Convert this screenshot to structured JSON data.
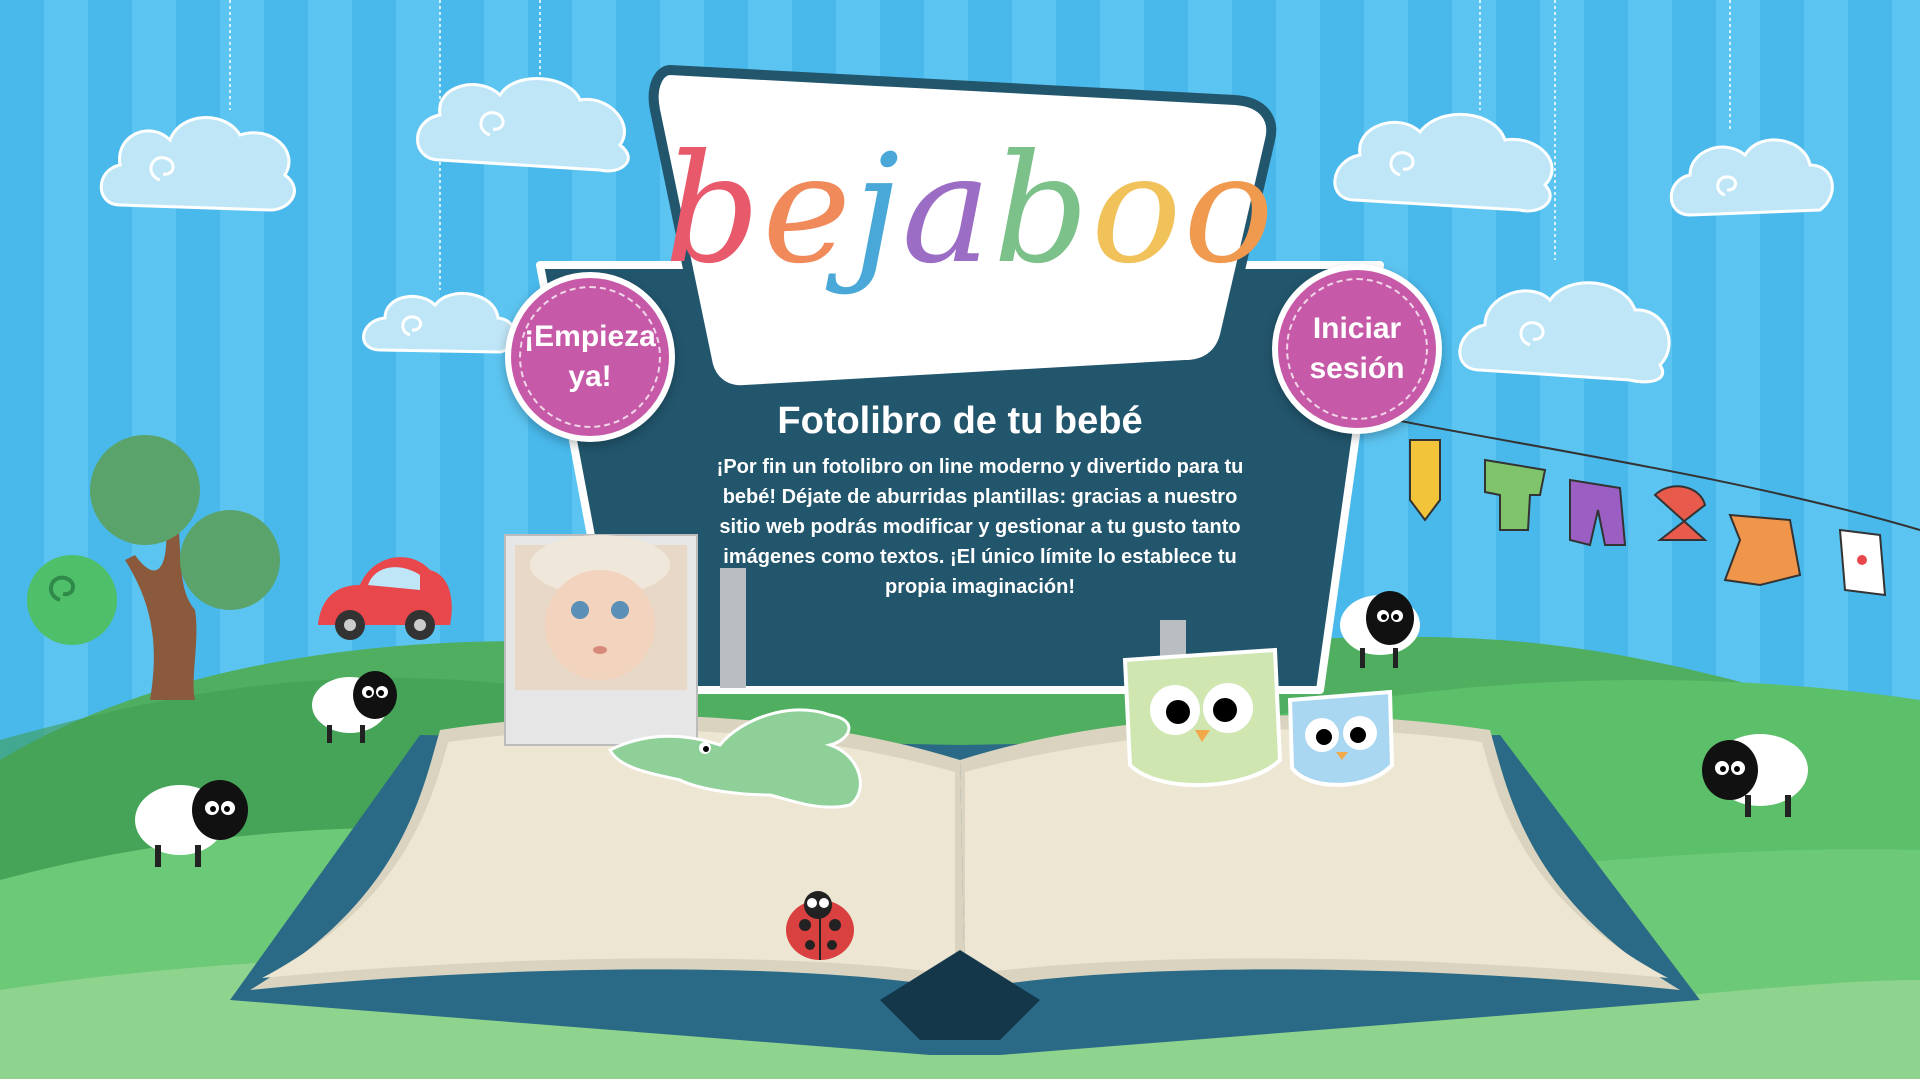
{
  "logo": {
    "letters": [
      "b",
      "e",
      "j",
      "a",
      "b",
      "o",
      "o"
    ],
    "colors": [
      "#e85a6b",
      "#f08a5a",
      "#4aa8d8",
      "#9b6dc4",
      "#7cc08a",
      "#f1c15a",
      "#f09a50"
    ]
  },
  "headline": "Fotolibro de tu bebé",
  "intro": "¡Por fin un fotolibro on line moderno y divertido para tu bebé! Déjate de aburridas plantillas: gracias a nuestro sitio web podrás modificar y gestionar a tu gusto tanto imágenes como textos. ¡El único límite lo establece tu propia imaginación!",
  "buttons": {
    "start_label": "¡Empieza\nya!",
    "login_label": "Iniciar\nsesión"
  },
  "icons": [
    "cloud-icon",
    "tree-icon",
    "car-icon",
    "sheep-icon",
    "owl-icon",
    "crocodile-icon",
    "ladybug-icon",
    "clothesline-icon",
    "open-book-icon",
    "baby-photo"
  ],
  "colors": {
    "sky": "#49b8ea",
    "hill": "#5cbf6a",
    "sign": "#22566d",
    "button": "#c75aa8"
  }
}
